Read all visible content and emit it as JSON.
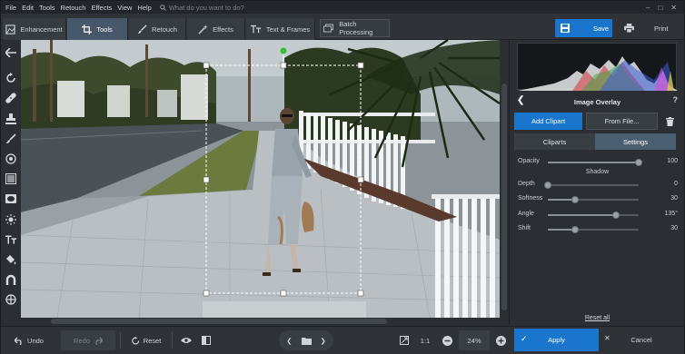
{
  "menu": {
    "items": [
      "File",
      "Edit",
      "Tools",
      "Retouch",
      "Effects",
      "View",
      "Help"
    ],
    "search_placeholder": "What do you want to do?"
  },
  "toolbar": {
    "tabs": [
      {
        "label": "Enhancement",
        "icon": "enhancement-icon"
      },
      {
        "label": "Tools",
        "icon": "crop-icon",
        "active": true
      },
      {
        "label": "Retouch",
        "icon": "brush-icon"
      },
      {
        "label": "Effects",
        "icon": "magic-wand-icon"
      },
      {
        "label": "Text & Frames",
        "icon": "text-icon"
      }
    ],
    "batch_label": "Batch Processing",
    "save_label": "Save",
    "print_label": "Print"
  },
  "panel": {
    "title": "Image Overlay",
    "help": "?",
    "add_clipart": "Add Clipart",
    "from_file": "From File...",
    "tabs": [
      {
        "label": "Cliparts"
      },
      {
        "label": "Settings",
        "active": true
      }
    ],
    "opacity": {
      "label": "Opacity",
      "value": "100",
      "fraction": 1.0
    },
    "shadow_header": "Shadow",
    "depth": {
      "label": "Depth",
      "value": "0",
      "fraction": 0.0
    },
    "softness": {
      "label": "Softness",
      "value": "30",
      "fraction": 0.3
    },
    "angle": {
      "label": "Angle",
      "value": "135°",
      "fraction": 0.75
    },
    "shift": {
      "label": "Shift",
      "value": "30",
      "fraction": 0.3
    },
    "reset_all": "Reset all"
  },
  "bottom": {
    "undo": "Undo",
    "redo": "Redo",
    "reset": "Reset",
    "ratio": "1:1",
    "zoom": "24%",
    "apply": "Apply",
    "cancel": "Cancel"
  },
  "colors": {
    "accent": "#1a76cc",
    "active_tab": "#47586a",
    "background": "#2b2f33"
  }
}
